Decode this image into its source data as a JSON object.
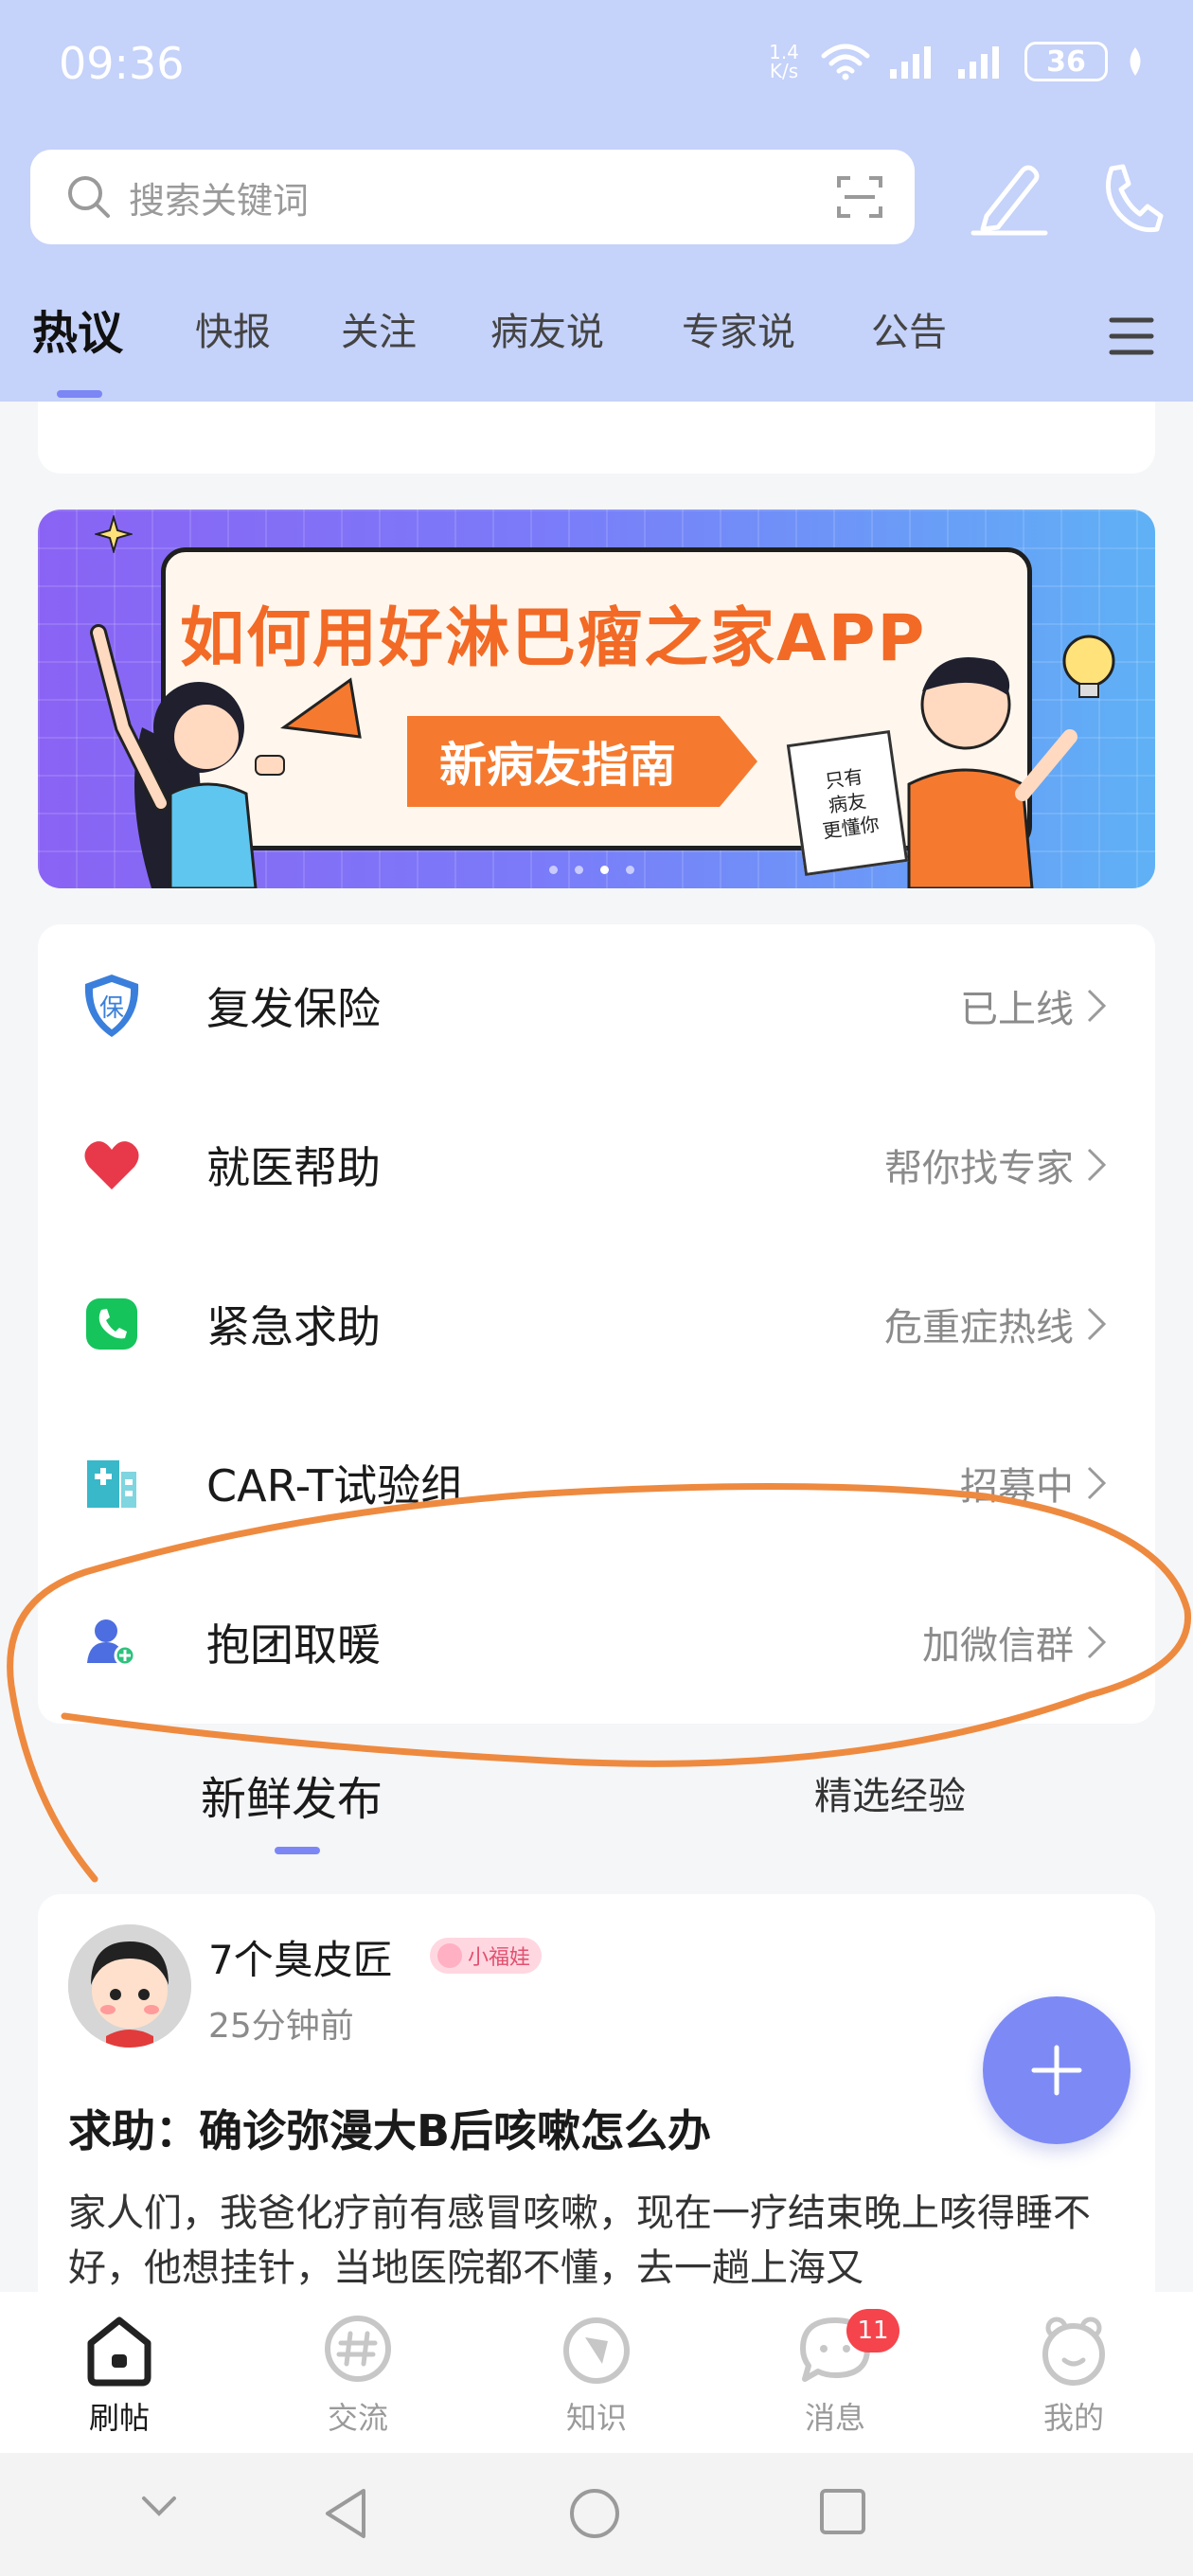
{
  "status_bar": {
    "time": "09:36",
    "net_speed_value": "1.4",
    "net_speed_unit": "K/s",
    "battery": "36"
  },
  "search": {
    "placeholder": "搜索关键词"
  },
  "tabs": [
    {
      "label": "热议",
      "active": true
    },
    {
      "label": "快报",
      "active": false
    },
    {
      "label": "关注",
      "active": false
    },
    {
      "label": "病友说",
      "active": false
    },
    {
      "label": "专家说",
      "active": false
    },
    {
      "label": "公告",
      "active": false
    }
  ],
  "banner": {
    "title": "如何用好淋巴瘤之家APP",
    "tag": "新病友指南",
    "sign_lines": [
      "只有",
      "病友",
      "更懂你"
    ],
    "dots": 4,
    "active_dot": 3
  },
  "services": [
    {
      "label": "复发保险",
      "status": "已上线",
      "icon": "shield-icon"
    },
    {
      "label": "就医帮助",
      "status": "帮你找专家",
      "icon": "heart-icon"
    },
    {
      "label": "紧急求助",
      "status": "危重症热线",
      "icon": "phone-icon"
    },
    {
      "label": "CAR-T试验组",
      "status": "招募中",
      "icon": "hospital-icon"
    },
    {
      "label": "抱团取暖",
      "status": "加微信群",
      "icon": "add-user-icon"
    }
  ],
  "feed_tabs": {
    "active": "新鲜发布",
    "inactive": "精选经验"
  },
  "post": {
    "author": "7个臭皮匠",
    "badge": "小福娃",
    "time": "25分钟前",
    "title": "求助：确诊弥漫大B后咳嗽怎么办",
    "body": "家人们，我爸化疗前有感冒咳嗽，现在一疗结束晚上咳得睡不好，他想挂针，当地医院都不懂，去一趟上海又"
  },
  "bottom_nav": [
    {
      "label": "刷帖",
      "icon": "home-icon",
      "active": true
    },
    {
      "label": "交流",
      "icon": "hashtag-icon",
      "active": false
    },
    {
      "label": "知识",
      "icon": "compass-icon",
      "active": false
    },
    {
      "label": "消息",
      "icon": "chat-icon",
      "active": false,
      "badge": "11"
    },
    {
      "label": "我的",
      "icon": "profile-icon",
      "active": false
    }
  ],
  "colors": {
    "header_bg": "#c5d2f9",
    "accent": "#7d8af5",
    "annotation": "#ee8a3f",
    "badge_red": "#f5444c"
  }
}
